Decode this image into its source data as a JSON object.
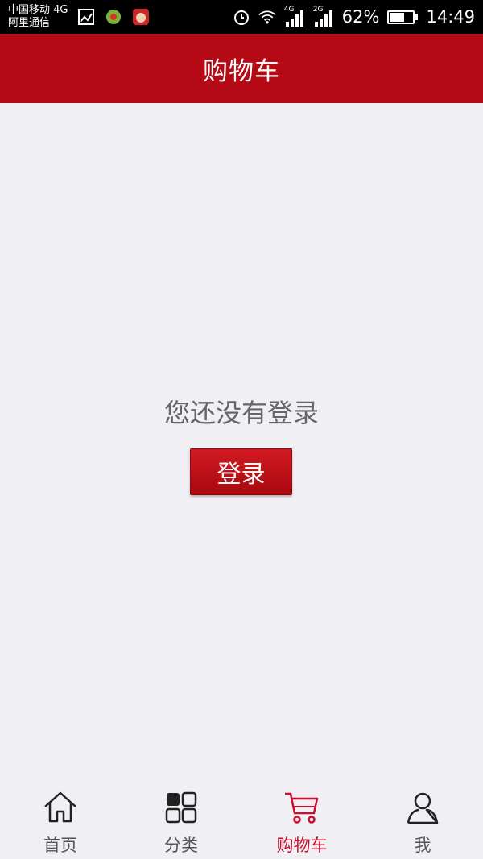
{
  "status_bar": {
    "carrier_line1": "中国移动 4G",
    "carrier_line2": "阿里通信",
    "net1_label": "4G",
    "net2_label": "2G",
    "battery_percent": "62%",
    "battery_level": 0.62,
    "time": "14:49",
    "icons": [
      "image-icon",
      "app-icon",
      "app-icon-2",
      "alarm-icon",
      "wifi-icon",
      "signal-icon",
      "signal-icon",
      "battery-icon"
    ]
  },
  "header": {
    "title": "购物车"
  },
  "main": {
    "not_logged_in_message": "您还没有登录",
    "login_button": "登录"
  },
  "tabs": [
    {
      "label": "首页",
      "icon": "home-icon"
    },
    {
      "label": "分类",
      "icon": "grid-icon"
    },
    {
      "label": "购物车",
      "icon": "cart-icon",
      "active": true
    },
    {
      "label": "我",
      "icon": "user-icon"
    }
  ],
  "colors": {
    "brand_red": "#b50a15",
    "active_tab": "#c8102e",
    "background": "#efeff4"
  }
}
